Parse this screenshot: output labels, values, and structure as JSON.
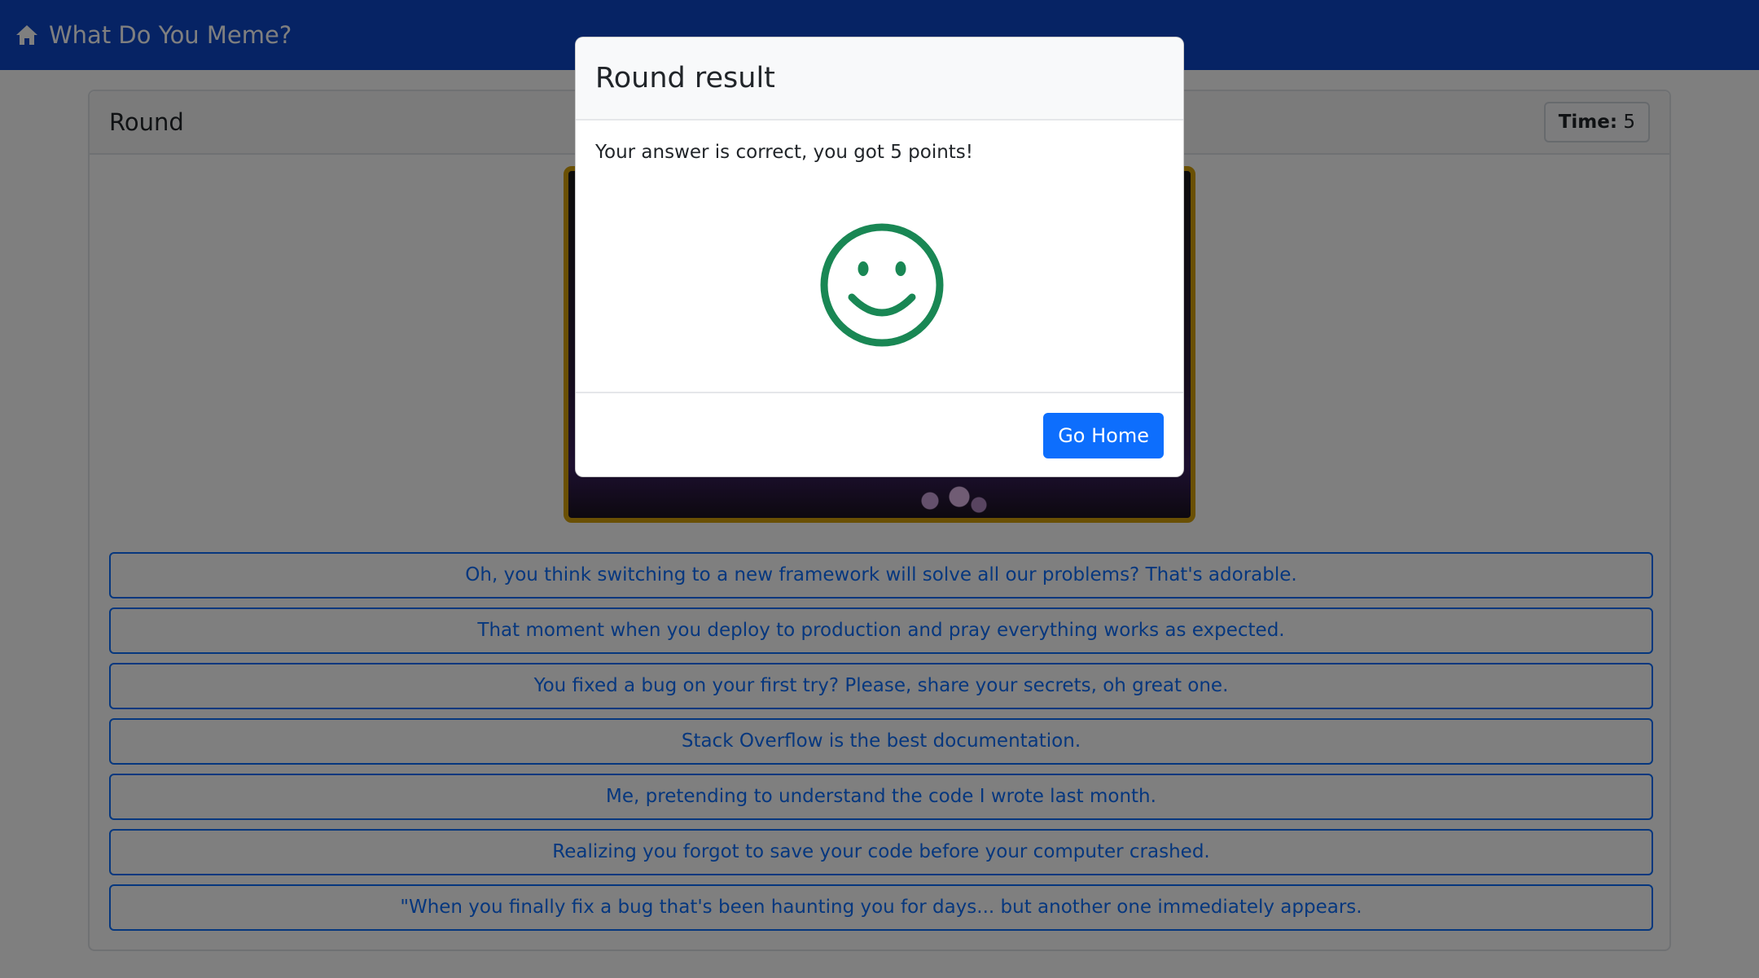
{
  "navbar": {
    "brand_icon": "home-icon",
    "brand_label": "What Do You Meme?"
  },
  "round": {
    "title": "Round",
    "timer_label": "Time:",
    "timer_value": "5"
  },
  "answers": [
    "Oh, you think switching to a new framework will solve all our problems? That's adorable.",
    "That moment when you deploy to production and pray everything works as expected.",
    "You fixed a bug on your first try? Please, share your secrets, oh great one.",
    "Stack Overflow is the best documentation.",
    "Me, pretending to understand the code I wrote last month.",
    "Realizing you forgot to save your code before your computer crashed.",
    "\"When you finally fix a bug that's been haunting you for days... but another one immediately appears."
  ],
  "modal": {
    "title": "Round result",
    "message": "Your answer is correct, you got 5 points!",
    "result_icon": "smiley-icon",
    "result_color": "#198754",
    "button_label": "Go Home"
  },
  "colors": {
    "navbar": "#0d47c9",
    "primary": "#0d6efd",
    "meme_border": "#d4a009"
  }
}
